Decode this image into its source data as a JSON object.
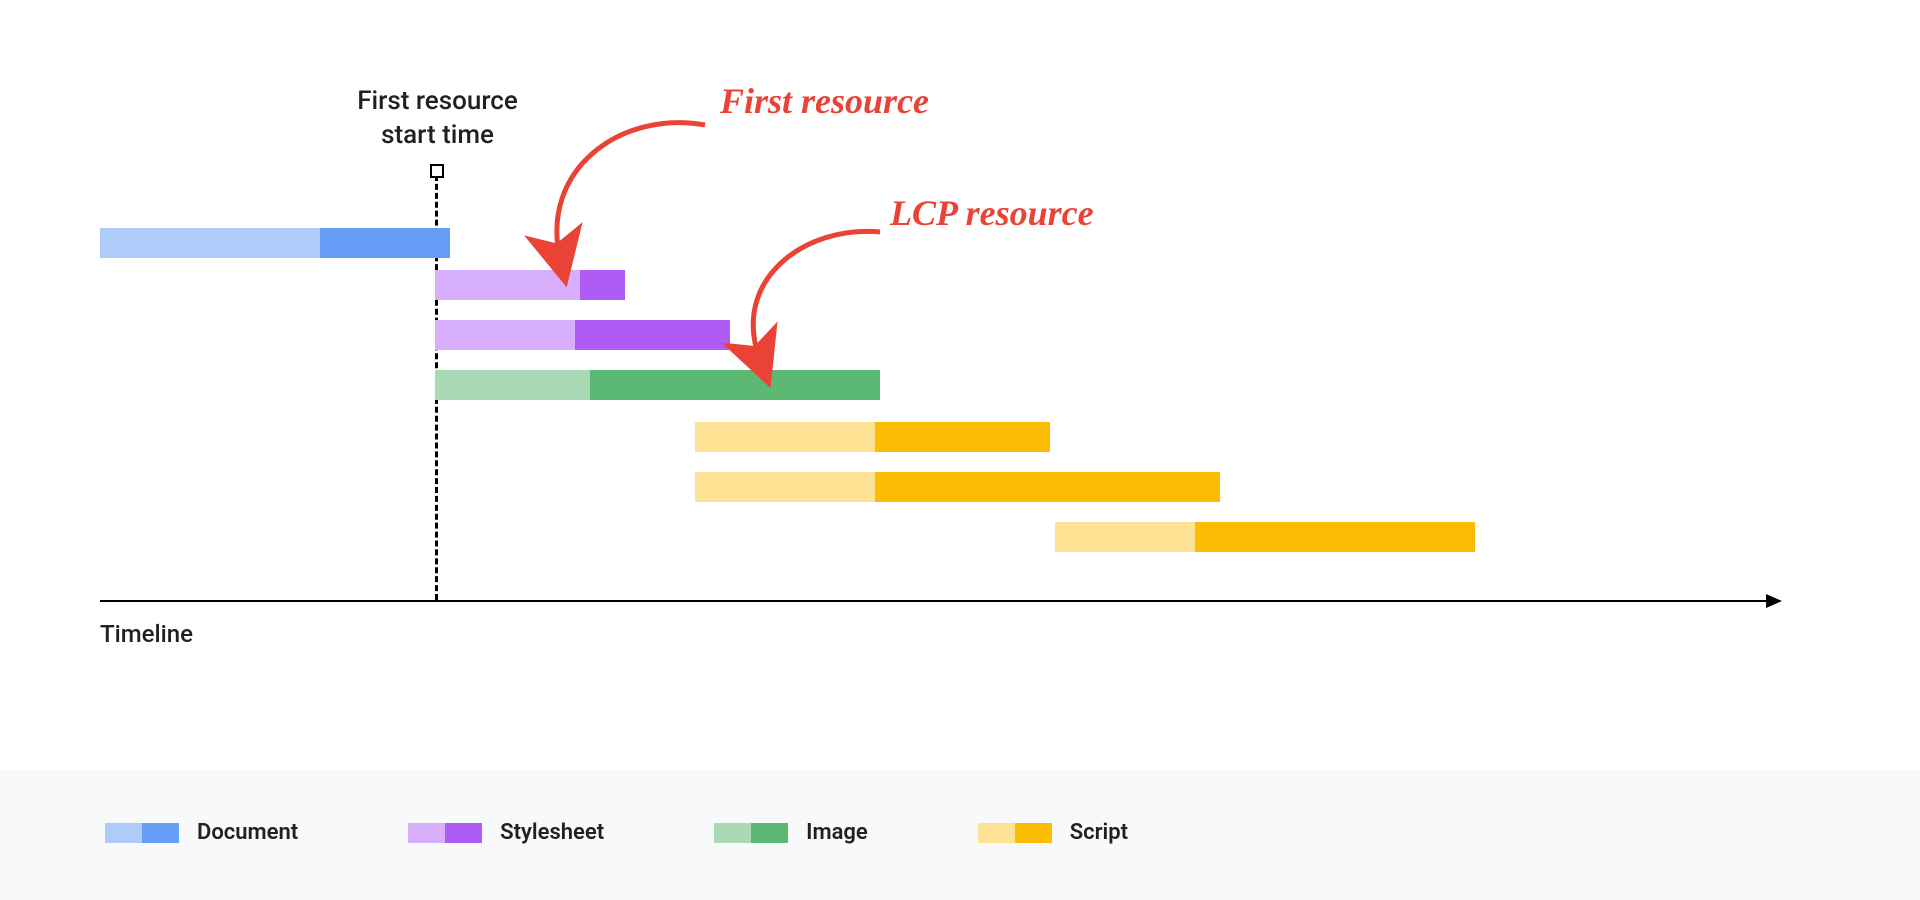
{
  "chart_data": {
    "type": "gantt",
    "title": "",
    "xlabel": "Timeline",
    "marker": {
      "label": "First resource\nstart time",
      "x": 335
    },
    "annotations": [
      {
        "text": "First resource",
        "target": "stylesheet-1"
      },
      {
        "text": "LCP resource",
        "target": "image-1"
      }
    ],
    "series": [
      {
        "name": "Document",
        "light": "#AECBFA",
        "dark": "#669DF6"
      },
      {
        "name": "Stylesheet",
        "light": "#D7AEFB",
        "dark": "#AF5CF7"
      },
      {
        "name": "Image",
        "light": "#A8DAB5",
        "dark": "#5BB974"
      },
      {
        "name": "Script",
        "light": "#FDE293",
        "dark": "#FBBC04"
      }
    ],
    "bars": [
      {
        "series": "Document",
        "start": 0,
        "split": 220,
        "end": 350
      },
      {
        "series": "Stylesheet",
        "start": 335,
        "split": 480,
        "end": 525
      },
      {
        "series": "Stylesheet",
        "start": 335,
        "split": 475,
        "end": 630
      },
      {
        "series": "Image",
        "start": 335,
        "split": 490,
        "end": 780
      },
      {
        "series": "Script",
        "start": 595,
        "split": 775,
        "end": 950
      },
      {
        "series": "Script",
        "start": 595,
        "split": 775,
        "end": 1120
      },
      {
        "series": "Script",
        "start": 955,
        "split": 1095,
        "end": 1375
      }
    ],
    "legend": [
      {
        "label": "Document",
        "light": "#AECBFA",
        "dark": "#669DF6"
      },
      {
        "label": "Stylesheet",
        "light": "#D7AEFB",
        "dark": "#AF5CF7"
      },
      {
        "label": "Image",
        "light": "#A8DAB5",
        "dark": "#5BB974"
      },
      {
        "label": "Script",
        "light": "#FDE293",
        "dark": "#FBBC04"
      }
    ]
  },
  "labels": {
    "timeline": "Timeline",
    "marker_line1": "First resource",
    "marker_line2": "start time",
    "annot1": "First resource",
    "annot2": "LCP resource",
    "legend_document": "Document",
    "legend_stylesheet": "Stylesheet",
    "legend_image": "Image",
    "legend_script": "Script"
  }
}
